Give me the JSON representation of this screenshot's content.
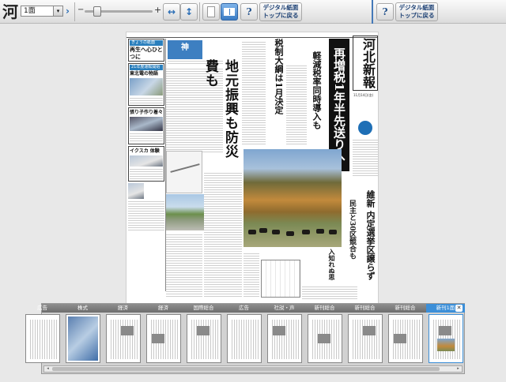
{
  "toolbar": {
    "logo_glyph": "河",
    "page_select_value": "1面",
    "dropdown_arrow": "▾",
    "next_page_glyph": "›",
    "zoom_out_glyph": "−",
    "zoom_in_glyph": "+",
    "fit_width_glyph": "↔",
    "fit_height_glyph": "↕",
    "help_glyph": "?",
    "digital_top_label_line1": "デジタル紙面",
    "digital_top_label_line2": "トップに戻る"
  },
  "icons": {
    "logo": "kahoku-logo-icon",
    "next": "chevron-right-icon",
    "fit_width": "fit-width-icon",
    "fit_height": "fit-height-icon",
    "single_page": "single-page-icon",
    "spread": "two-page-spread-icon",
    "help": "help-icon",
    "close": "close-icon"
  },
  "newspaper": {
    "masthead": "河北新報",
    "masthead_date": "11月14日(金)",
    "black_band": "再増税1年半先送りへ",
    "tax_headline": "税制大綱は1月決定",
    "keigen_headline": "軽減税率同時導入も",
    "main_vertical_headline": "地元振興も防災費も",
    "kanban": "神",
    "left_col": [
      {
        "tag": "きょうの紙面",
        "head": "再生へ心ひとつに"
      },
      {
        "tag": "21年度運転開始",
        "head": "東北電の物語"
      },
      {
        "tag": "",
        "head": "張り子作り着々"
      },
      {
        "tag": "",
        "head": "イクスカ 体験"
      }
    ],
    "bottom_right_headline": "維新 内定選挙区譲らず",
    "bottom_right_sub": "民主と30区競合も",
    "small_headline": "入知れぬ思"
  },
  "thumbnails": [
    {
      "label": "広告"
    },
    {
      "label": "株式"
    },
    {
      "label": "経済"
    },
    {
      "label": "経済"
    },
    {
      "label": "国際総合"
    },
    {
      "label": "広告"
    },
    {
      "label": "社説・声"
    },
    {
      "label": "新刊総合"
    },
    {
      "label": "新刊総合"
    },
    {
      "label": "新刊総合"
    },
    {
      "label": "新刊1面"
    }
  ],
  "thumbnail_active_index": 10,
  "strip_close_glyph": "✕",
  "scroll_left_glyph": "◂",
  "scroll_right_glyph": "▸",
  "colors": {
    "accent": "#3c8fd8",
    "spread_button": "#3b7cc4",
    "divider": "#4479b8"
  }
}
